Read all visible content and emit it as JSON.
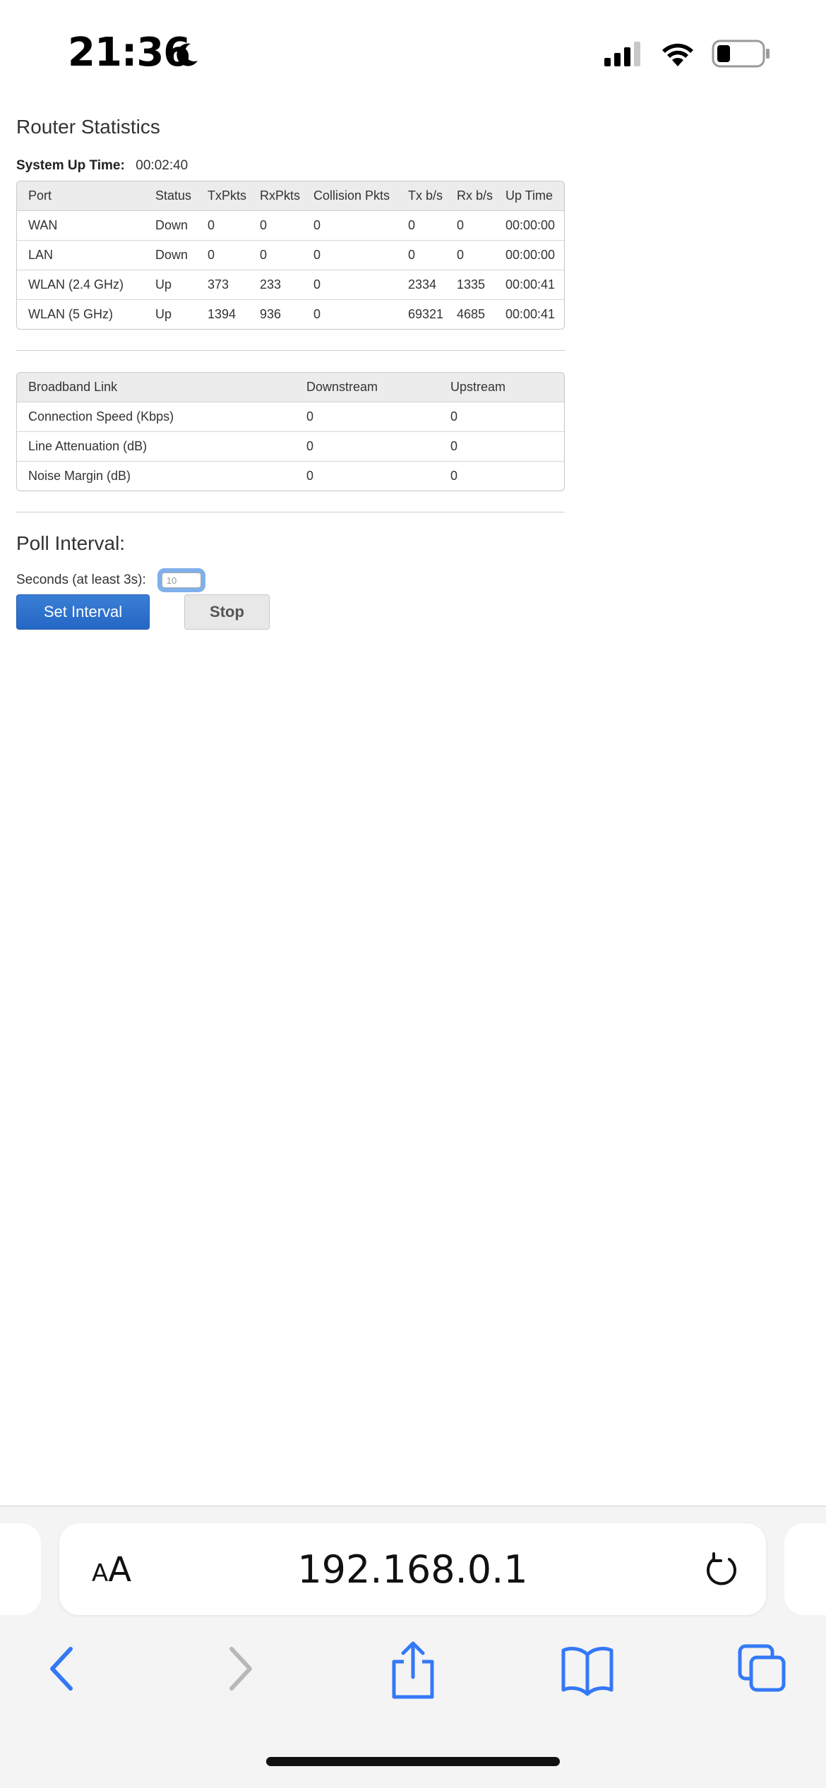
{
  "status_bar": {
    "time": "21:36",
    "icons": [
      "moon-icon",
      "signal-icon",
      "wifi-icon",
      "battery-icon"
    ]
  },
  "page": {
    "title": "Router Statistics",
    "uptime_label": "System Up Time:",
    "uptime_value": "00:02:40"
  },
  "port_table": {
    "headers": [
      "Port",
      "Status",
      "TxPkts",
      "RxPkts",
      "Collision Pkts",
      "Tx b/s",
      "Rx b/s",
      "Up Time"
    ],
    "rows": [
      [
        "WAN",
        "Down",
        "0",
        "0",
        "0",
        "0",
        "0",
        "00:00:00"
      ],
      [
        "LAN",
        "Down",
        "0",
        "0",
        "0",
        "0",
        "0",
        "00:00:00"
      ],
      [
        "WLAN (2.4 GHz)",
        "Up",
        "373",
        "233",
        "0",
        "2334",
        "1335",
        "00:00:41"
      ],
      [
        "WLAN (5 GHz)",
        "Up",
        "1394",
        "936",
        "0",
        "69321",
        "4685",
        "00:00:41"
      ]
    ]
  },
  "broadband_table": {
    "headers": [
      "Broadband Link",
      "Downstream",
      "Upstream"
    ],
    "rows": [
      [
        "Connection Speed (Kbps)",
        "0",
        "0"
      ],
      [
        "Line Attenuation (dB)",
        "0",
        "0"
      ],
      [
        "Noise Margin (dB)",
        "0",
        "0"
      ]
    ]
  },
  "poll": {
    "title": "Poll Interval:",
    "seconds_label": "Seconds (at least 3s):",
    "seconds_value": "10",
    "set_button": "Set Interval",
    "stop_button": "Stop"
  },
  "browser": {
    "text_size_small": "A",
    "text_size_big": "A",
    "url": "192.168.0.1",
    "accent_color": "#3478f6"
  }
}
